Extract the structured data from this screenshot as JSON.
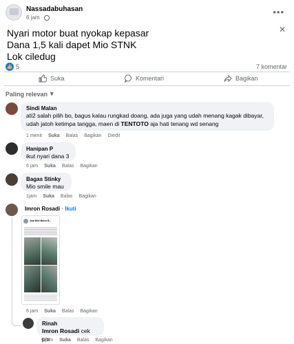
{
  "post": {
    "author": "Nassadabuhasan",
    "time": "6 jam",
    "text": "Nyari motor buat nyokap kepasar\nDana 1,5 kali dapet Mio STNK\nLok ciledug",
    "reaction_count": "5",
    "comment_count": "7 komentar",
    "icons": {
      "more": "more-icon",
      "close": "close-icon",
      "privacy": "globe-icon"
    }
  },
  "actions": {
    "like": "Suka",
    "comment": "Komentari",
    "share": "Bagikan"
  },
  "sort_label": "Paling relevan",
  "comments": [
    {
      "name": "Sindi Malan",
      "text_a": "ati2 salah pilih bo, bagus kalau rungkad doang, ada juga yang udah menang kagak dibayar, udah jatoh ketimpa tangga, maen di ",
      "text_bold": "TENTOTO",
      "text_b": " aja hati tenang wd senang",
      "time": "1 menit",
      "like": "Suka",
      "reply": "Balas",
      "share": "Bagikan",
      "edited": "Diedit"
    },
    {
      "name": "Hanipan P",
      "text": "ikut nyari dana 3",
      "time": "6 jam",
      "like": "Suka",
      "reply": "Balas",
      "share": "Bagikan"
    },
    {
      "name": "Bagas Stinky",
      "text": "Mio smile mau",
      "time": "1jam",
      "like": "Suka",
      "reply": "Balas",
      "share": "Bagikan"
    },
    {
      "name": "Imron Rosadi",
      "follow": "· Ikuti",
      "time": "6 jam",
      "like": "Suka",
      "reply": "Balas",
      "share": "Bagikan"
    },
    {
      "name": "Rinah",
      "tag": "Imron Rosadi",
      "text": " cek pm",
      "time": "6 jam",
      "like": "Suka",
      "reply": "Balas",
      "share": "Bagikan"
    }
  ],
  "screenshot": {
    "title": "Jual Beli Motor B..."
  }
}
